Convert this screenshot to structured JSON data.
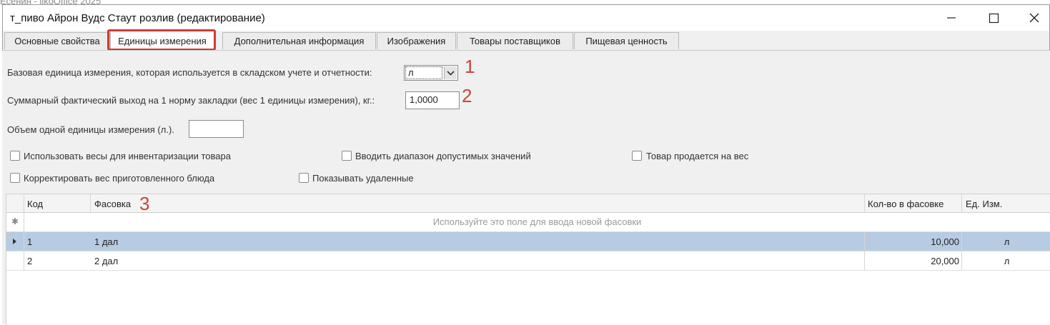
{
  "background_title": "Есенин - iikoOffice 2025",
  "window": {
    "title": "т_пиво Айрон Вудс Стаут розлив (редактирование)"
  },
  "tabs": [
    {
      "label": "Основные свойства"
    },
    {
      "label": "Единицы измерения"
    },
    {
      "label": "Дополнительная информация"
    },
    {
      "label": "Изображения"
    },
    {
      "label": "Товары поставщиков"
    },
    {
      "label": "Пищевая ценность"
    }
  ],
  "form": {
    "base_unit_label": "Базовая единица измерения, которая используется в складском учете и отчетности:",
    "base_unit_value": "л",
    "yield_label": "Суммарный фактический выход на 1 норму закладки (вес 1 единицы измерения), кг.:",
    "yield_value": "1,0000",
    "volume_label": "Объем одной единицы измерения (л.).",
    "volume_value": ""
  },
  "checkboxes": {
    "use_scales": "Использовать весы для инвентаризации товара",
    "enter_range": "Вводить диапазон допустимых значений",
    "sold_by_weight": "Товар продается на вес",
    "correct_weight": "Корректировать вес приготовленного блюда",
    "show_deleted": "Показывать удаленные"
  },
  "annotations": {
    "a1": "1",
    "a2": "2",
    "a3": "3"
  },
  "grid": {
    "headers": {
      "code": "Код",
      "packing": "Фасовка",
      "qty": "Кол-во в фасовке",
      "unit": "Ед. Изм."
    },
    "new_row_hint": "Используйте это поле для ввода новой фасовки",
    "rows": [
      {
        "code": "1",
        "packing": "1 дал",
        "qty": "10,000",
        "unit": "л"
      },
      {
        "code": "2",
        "packing": "2 дал",
        "qty": "20,000",
        "unit": "л"
      }
    ]
  },
  "colors": {
    "highlight": "#d23b33",
    "selected_row": "#b7cbe3"
  }
}
